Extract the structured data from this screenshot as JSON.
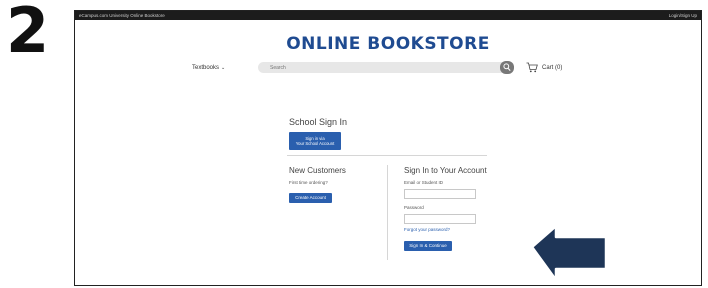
{
  "step_number": "2",
  "topbar": {
    "site_name": "eCampus.com University Online Bookstore",
    "login_link": "Login/Sign Up"
  },
  "header": {
    "logo_text": "ONLINE BOOKSTORE",
    "textbooks_menu": "Textbooks",
    "search_placeholder": "Search",
    "cart_label": "Cart (0)"
  },
  "school_signin": {
    "title": "School Sign In",
    "button_line1": "Sign in via",
    "button_line2": "Your School Account"
  },
  "new_customers": {
    "title": "New Customers",
    "subtitle": "First time ordering?",
    "button": "Create Account"
  },
  "account_signin": {
    "title": "Sign In to Your Account",
    "email_label": "Email or Student ID",
    "password_label": "Password",
    "forgot_link": "Forgot your password?",
    "button": "Sign In & Continue"
  },
  "colors": {
    "brand_blue": "#2a5fae",
    "logo_blue": "#1f4b91",
    "arrow_navy": "#1e3557",
    "topbar": "#1c1c1c"
  },
  "icons": [
    "search-icon",
    "cart-icon",
    "chevron-down-icon",
    "pointer-arrow-icon"
  ]
}
